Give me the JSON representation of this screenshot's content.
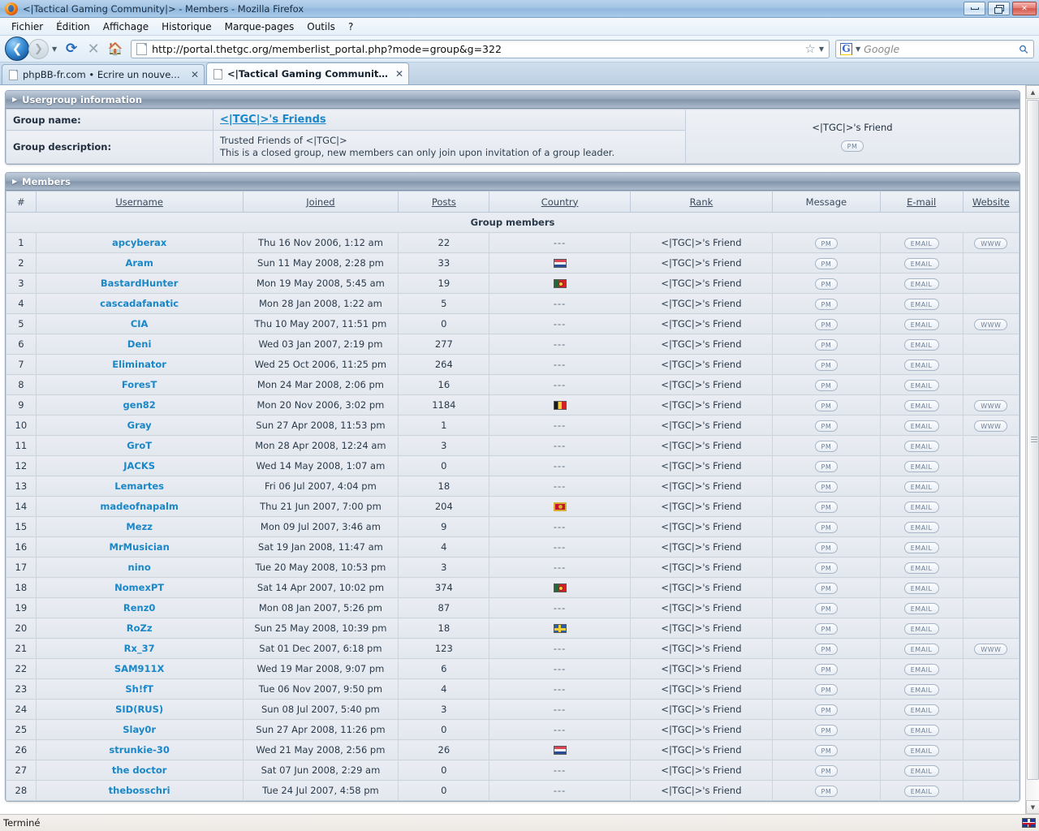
{
  "window": {
    "title": "<|Tactical Gaming Community|> - Members - Mozilla Firefox",
    "minimize_label": "Minimize",
    "restore_label": "Restore",
    "close_label": "Close"
  },
  "menubar": [
    {
      "label": "Fichier"
    },
    {
      "label": "Édition"
    },
    {
      "label": "Affichage"
    },
    {
      "label": "Historique"
    },
    {
      "label": "Marque-pages"
    },
    {
      "label": "Outils"
    },
    {
      "label": "?"
    }
  ],
  "toolbar": {
    "url": "http://portal.thetgc.org/memberlist_portal.php?mode=group&g=322",
    "search_placeholder": "Google",
    "search_engine": "G",
    "back_label": "Back",
    "forward_label": "Forward",
    "reload_label": "Reload",
    "stop_label": "Stop",
    "home_label": "Home"
  },
  "tabs": [
    {
      "label": "phpBB-fr.com • Ecrire un nouveau s...",
      "active": false
    },
    {
      "label": "<|Tactical Gaming Community|> -...",
      "active": true
    }
  ],
  "usergroup": {
    "panel_title": "Usergroup information",
    "name_label": "Group name:",
    "name_value": "<|TGC|>'s Friends",
    "desc_label": "Group description:",
    "desc_line1": "Trusted Friends of <|TGC|>",
    "desc_line2": "This is a closed group, new members can only join upon invitation of a group leader.",
    "leader_rank": "<|TGC|>'s Friend",
    "leader_pm": "PM"
  },
  "members": {
    "panel_title": "Members",
    "group_members_label": "Group members",
    "columns": [
      "#",
      "Username",
      "Joined",
      "Posts",
      "Country",
      "Rank",
      "Message",
      "E-mail",
      "Website"
    ],
    "pm_label": "PM",
    "email_label": "EMAIL",
    "www_label": "WWW",
    "no_country": "---",
    "rows": [
      {
        "num": "1",
        "username": "apcyberax",
        "joined": "Thu 16 Nov 2006, 1:12 am",
        "posts": "22",
        "country": "",
        "rank": "<|TGC|>'s Friend",
        "web": true
      },
      {
        "num": "2",
        "username": "Aram",
        "joined": "Sun 11 May 2008, 2:28 pm",
        "posts": "33",
        "country": "nl",
        "rank": "<|TGC|>'s Friend",
        "web": false
      },
      {
        "num": "3",
        "username": "BastardHunter",
        "joined": "Mon 19 May 2008, 5:45 am",
        "posts": "19",
        "country": "pt",
        "rank": "<|TGC|>'s Friend",
        "web": false
      },
      {
        "num": "4",
        "username": "cascadafanatic",
        "joined": "Mon 28 Jan 2008, 1:22 am",
        "posts": "5",
        "country": "",
        "rank": "<|TGC|>'s Friend",
        "web": false
      },
      {
        "num": "5",
        "username": "CIA",
        "joined": "Thu 10 May 2007, 11:51 pm",
        "posts": "0",
        "country": "",
        "rank": "<|TGC|>'s Friend",
        "web": true
      },
      {
        "num": "6",
        "username": "Deni",
        "joined": "Wed 03 Jan 2007, 2:19 pm",
        "posts": "277",
        "country": "",
        "rank": "<|TGC|>'s Friend",
        "web": false
      },
      {
        "num": "7",
        "username": "Eliminator",
        "joined": "Wed 25 Oct 2006, 11:25 pm",
        "posts": "264",
        "country": "",
        "rank": "<|TGC|>'s Friend",
        "web": false
      },
      {
        "num": "8",
        "username": "ForesT",
        "joined": "Mon 24 Mar 2008, 2:06 pm",
        "posts": "16",
        "country": "",
        "rank": "<|TGC|>'s Friend",
        "web": false
      },
      {
        "num": "9",
        "username": "gen82",
        "joined": "Mon 20 Nov 2006, 3:02 pm",
        "posts": "1184",
        "country": "be",
        "rank": "<|TGC|>'s Friend",
        "web": true
      },
      {
        "num": "10",
        "username": "Gray",
        "joined": "Sun 27 Apr 2008, 11:53 pm",
        "posts": "1",
        "country": "",
        "rank": "<|TGC|>'s Friend",
        "web": true
      },
      {
        "num": "11",
        "username": "GroT",
        "joined": "Mon 28 Apr 2008, 12:24 am",
        "posts": "3",
        "country": "",
        "rank": "<|TGC|>'s Friend",
        "web": false
      },
      {
        "num": "12",
        "username": "JACKS",
        "joined": "Wed 14 May 2008, 1:07 am",
        "posts": "0",
        "country": "",
        "rank": "<|TGC|>'s Friend",
        "web": false
      },
      {
        "num": "13",
        "username": "Lemartes",
        "joined": "Fri 06 Jul 2007, 4:04 pm",
        "posts": "18",
        "country": "",
        "rank": "<|TGC|>'s Friend",
        "web": false
      },
      {
        "num": "14",
        "username": "madeofnapalm",
        "joined": "Thu 21 Jun 2007, 7:00 pm",
        "posts": "204",
        "country": "me",
        "rank": "<|TGC|>'s Friend",
        "web": false
      },
      {
        "num": "15",
        "username": "Mezz",
        "joined": "Mon 09 Jul 2007, 3:46 am",
        "posts": "9",
        "country": "",
        "rank": "<|TGC|>'s Friend",
        "web": false
      },
      {
        "num": "16",
        "username": "MrMusician",
        "joined": "Sat 19 Jan 2008, 11:47 am",
        "posts": "4",
        "country": "",
        "rank": "<|TGC|>'s Friend",
        "web": false
      },
      {
        "num": "17",
        "username": "nino",
        "joined": "Tue 20 May 2008, 10:53 pm",
        "posts": "3",
        "country": "",
        "rank": "<|TGC|>'s Friend",
        "web": false
      },
      {
        "num": "18",
        "username": "NomexPT",
        "joined": "Sat 14 Apr 2007, 10:02 pm",
        "posts": "374",
        "country": "pt",
        "rank": "<|TGC|>'s Friend",
        "web": false
      },
      {
        "num": "19",
        "username": "Renz0",
        "joined": "Mon 08 Jan 2007, 5:26 pm",
        "posts": "87",
        "country": "",
        "rank": "<|TGC|>'s Friend",
        "web": false
      },
      {
        "num": "20",
        "username": "RoZz",
        "joined": "Sun 25 May 2008, 10:39 pm",
        "posts": "18",
        "country": "se",
        "rank": "<|TGC|>'s Friend",
        "web": false
      },
      {
        "num": "21",
        "username": "Rx_37",
        "joined": "Sat 01 Dec 2007, 6:18 pm",
        "posts": "123",
        "country": "",
        "rank": "<|TGC|>'s Friend",
        "web": true
      },
      {
        "num": "22",
        "username": "SAM911X",
        "joined": "Wed 19 Mar 2008, 9:07 pm",
        "posts": "6",
        "country": "",
        "rank": "<|TGC|>'s Friend",
        "web": false
      },
      {
        "num": "23",
        "username": "Sh!fT",
        "joined": "Tue 06 Nov 2007, 9:50 pm",
        "posts": "4",
        "country": "",
        "rank": "<|TGC|>'s Friend",
        "web": false
      },
      {
        "num": "24",
        "username": "SID(RUS)",
        "joined": "Sun 08 Jul 2007, 5:40 pm",
        "posts": "3",
        "country": "",
        "rank": "<|TGC|>'s Friend",
        "web": false
      },
      {
        "num": "25",
        "username": "Slay0r",
        "joined": "Sun 27 Apr 2008, 11:26 pm",
        "posts": "0",
        "country": "",
        "rank": "<|TGC|>'s Friend",
        "web": false
      },
      {
        "num": "26",
        "username": "strunkie-30",
        "joined": "Wed 21 May 2008, 2:56 pm",
        "posts": "26",
        "country": "nl",
        "rank": "<|TGC|>'s Friend",
        "web": false
      },
      {
        "num": "27",
        "username": "the doctor",
        "joined": "Sat 07 Jun 2008, 2:29 am",
        "posts": "0",
        "country": "",
        "rank": "<|TGC|>'s Friend",
        "web": false
      },
      {
        "num": "28",
        "username": "thebosschri",
        "joined": "Tue 24 Jul 2007, 4:58 pm",
        "posts": "0",
        "country": "",
        "rank": "<|TGC|>'s Friend",
        "web": false
      }
    ]
  },
  "statusbar": {
    "text": "Terminé",
    "language_icon": "uk-flag-icon"
  },
  "colors": {
    "link": "#1a87c8",
    "panel_header": "#8294ab",
    "row_bg": "#e6eaf1"
  }
}
